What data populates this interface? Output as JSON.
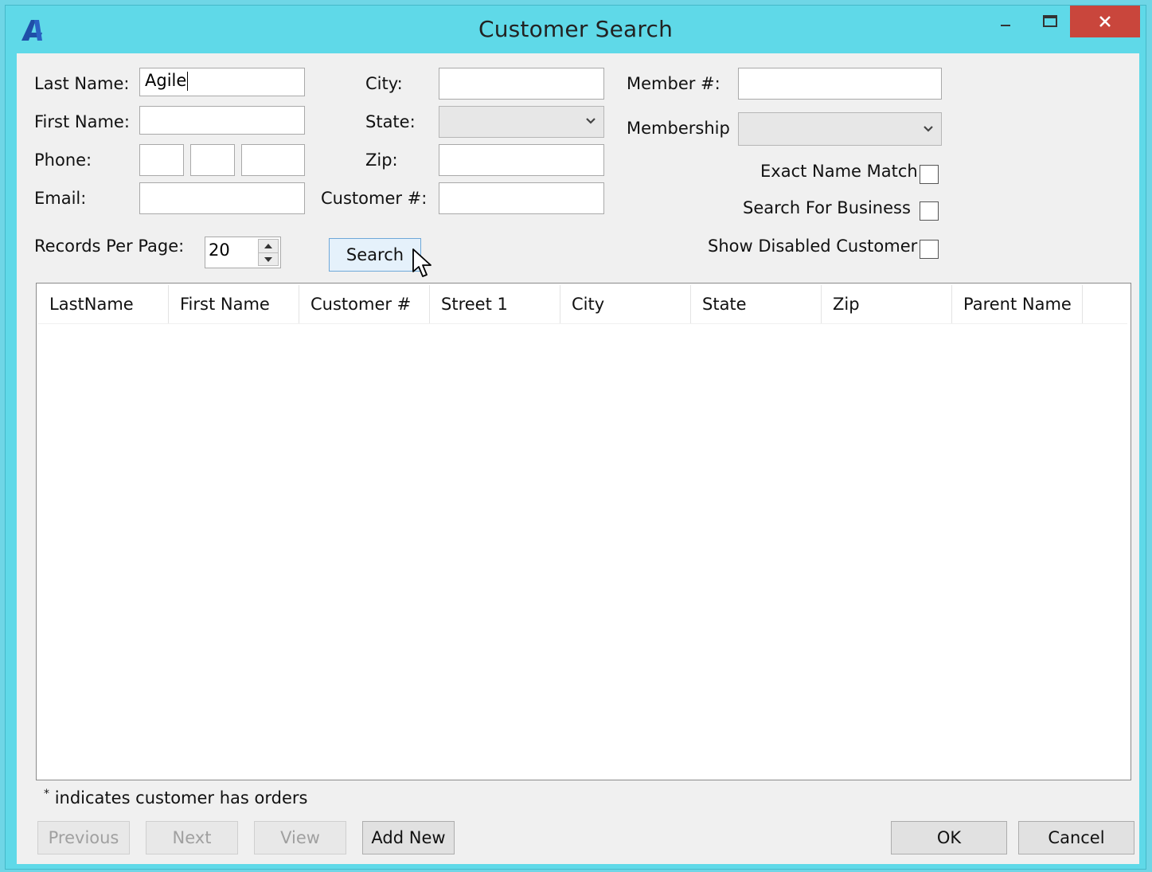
{
  "window": {
    "title": "Customer Search"
  },
  "form": {
    "last_name_label": "Last Name:",
    "last_name_value": "Agile",
    "first_name_label": "First Name:",
    "phone_label": "Phone:",
    "email_label": "Email:",
    "city_label": "City:",
    "state_label": "State:",
    "zip_label": "Zip:",
    "customer_no_label": "Customer #:",
    "member_no_label": "Member #:",
    "membership_label": "Membership",
    "exact_name_match_label": "Exact Name Match",
    "search_for_business_label": "Search For Business",
    "show_disabled_label": "Show Disabled Customer",
    "records_per_page_label": "Records Per Page:",
    "records_per_page_value": "20",
    "search_button": "Search"
  },
  "grid": {
    "columns": [
      "LastName",
      "First Name",
      "Customer #",
      "Street 1",
      "City",
      "State",
      "Zip",
      "Parent Name"
    ]
  },
  "footer": {
    "note_asterisk": "*",
    "note_text": "indicates customer has orders",
    "previous": "Previous",
    "next": "Next",
    "view": "View",
    "add_new": "Add New",
    "ok": "OK",
    "cancel": "Cancel"
  }
}
